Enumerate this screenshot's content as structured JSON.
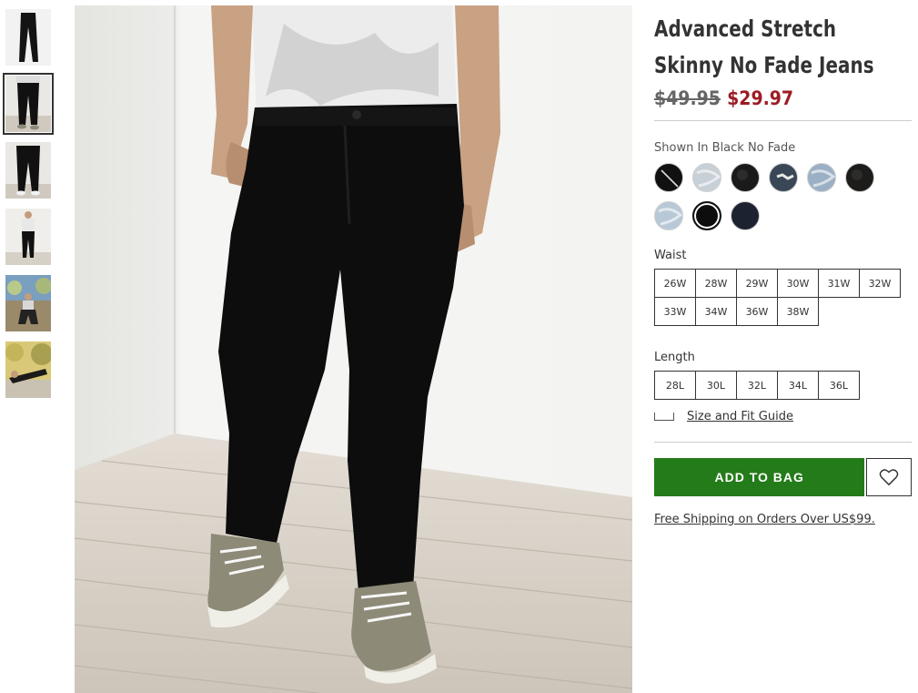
{
  "product": {
    "title_line1": "Advanced Stretch",
    "title_line2": "Skinny No Fade Jeans",
    "price_original": "$49.95",
    "price_sale": "$29.97",
    "shown_in": "Shown In Black No Fade"
  },
  "thumbnails": [
    {
      "name": "thumb-flat-jeans",
      "active": false
    },
    {
      "name": "thumb-front-legs",
      "active": true
    },
    {
      "name": "thumb-back-legs",
      "active": false
    },
    {
      "name": "thumb-full-body",
      "active": false
    },
    {
      "name": "thumb-outdoor-sitting",
      "active": false
    },
    {
      "name": "thumb-outdoor-lying",
      "active": false
    }
  ],
  "swatches": [
    {
      "color": "#111111",
      "selected": false,
      "pattern": "slash"
    },
    {
      "color": "#c7d0d6",
      "selected": false,
      "pattern": "light"
    },
    {
      "color": "#1a1a1a",
      "selected": false,
      "pattern": "dark"
    },
    {
      "color": "#3a4756",
      "selected": false,
      "pattern": "ripped"
    },
    {
      "color": "#9bb0c4",
      "selected": false,
      "pattern": "light"
    },
    {
      "color": "#1e1c1a",
      "selected": false,
      "pattern": "dark"
    },
    {
      "color": "#b8c8d6",
      "selected": false,
      "pattern": "light"
    },
    {
      "color": "#0d0d0d",
      "selected": true,
      "pattern": "solid"
    },
    {
      "color": "#1c2230",
      "selected": false,
      "pattern": "solid"
    }
  ],
  "waist": {
    "label": "Waist",
    "sizes": [
      "26W",
      "28W",
      "29W",
      "30W",
      "31W",
      "32W",
      "33W",
      "34W",
      "36W",
      "38W"
    ]
  },
  "length": {
    "label": "Length",
    "sizes": [
      "28L",
      "30L",
      "32L",
      "34L",
      "36L"
    ]
  },
  "size_guide": "Size and Fit Guide",
  "add_to_bag": "ADD TO BAG",
  "shipping": "Free Shipping on Orders Over US$99.",
  "colors": {
    "add_to_bag": "#247b19",
    "sale_price": "#9d1c24"
  }
}
